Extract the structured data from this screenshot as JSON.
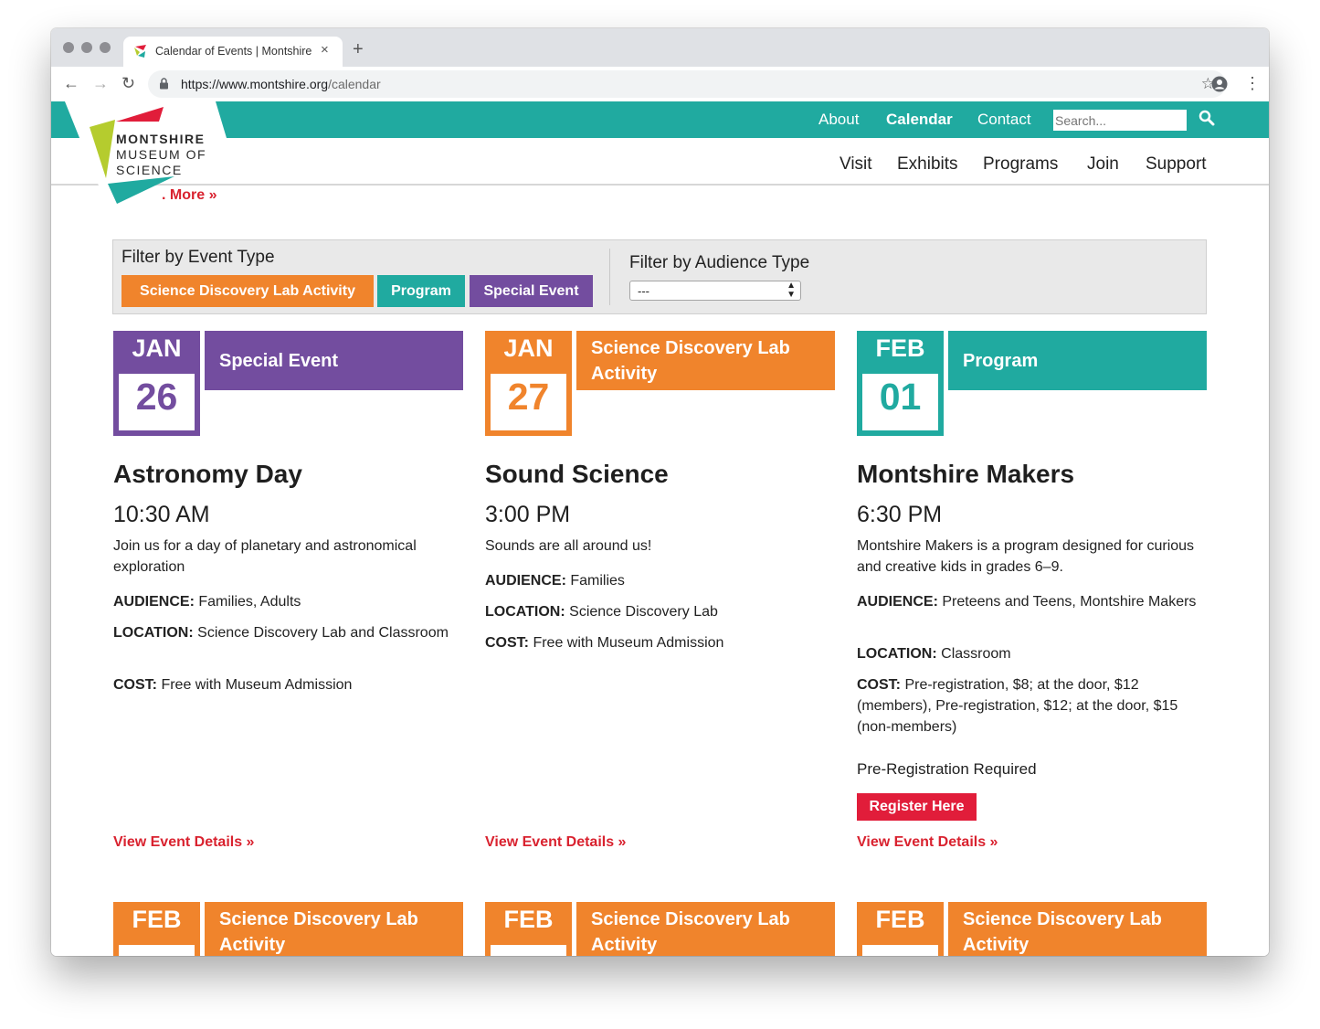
{
  "browser": {
    "tab_title": "Calendar of Events | Montshire",
    "tab_close": "×",
    "new_tab": "+",
    "url_host": "https://www.montshire.org",
    "url_path": "/calendar"
  },
  "site": {
    "top_nav": [
      "About",
      "Calendar",
      "Contact"
    ],
    "search_placeholder": "Search...",
    "main_nav": [
      "Visit",
      "Exhibits",
      "Programs",
      "Join",
      "Support"
    ],
    "logo_lines": [
      "MONTSHIRE",
      "MUSEUM OF",
      "SCIENCE"
    ],
    "read_more": ". More »"
  },
  "filter": {
    "event_heading": "Filter by Event Type",
    "buttons": [
      "Science Discovery Lab Activity",
      "Program",
      "Special Event"
    ],
    "audience_heading": "Filter by Audience Type",
    "audience_selected": "---"
  },
  "colors": {
    "teal": "#20aaa0",
    "orange": "#f0842c",
    "purple": "#734d9f",
    "red": "#d9222f"
  },
  "events": [
    {
      "month": "JAN",
      "day": "26",
      "type": "Special Event",
      "title": "Astronomy Day",
      "time": "10:30 AM",
      "description": "Join us for a day of planetary and astronomical exploration",
      "audience_label": "AUDIENCE:",
      "audience": "Families, Adults",
      "location_label": "LOCATION:",
      "location": "Science Discovery Lab and Classroom",
      "cost_label": "COST:",
      "cost": "Free with Museum Admission",
      "details": "View Event Details »"
    },
    {
      "month": "JAN",
      "day": "27",
      "type": "Science Discovery Lab Activity",
      "title": "Sound Science",
      "time": "3:00 PM",
      "description": "Sounds are all around us!",
      "audience_label": "AUDIENCE:",
      "audience": "Families",
      "location_label": "LOCATION:",
      "location": "Science Discovery Lab",
      "cost_label": "COST:",
      "cost": "Free with Museum Admission",
      "details": "View Event Details »"
    },
    {
      "month": "FEB",
      "day": "01",
      "type": "Program",
      "title": "Montshire Makers",
      "time": "6:30 PM",
      "description": "Montshire Makers is a program designed for curious and creative kids in grades 6–9.",
      "audience_label": "AUDIENCE:",
      "audience": "Preteens and Teens, Montshire Makers",
      "location_label": "LOCATION:",
      "location": "Classroom",
      "cost_label": "COST:",
      "cost": "Pre-registration, $8; at the door, $12 (members), Pre-registration, $12; at the door, $15 (non-members)",
      "prereg": "Pre-Registration Required",
      "register": "Register Here",
      "details": "View Event Details »"
    }
  ],
  "next_row": [
    {
      "month": "FEB",
      "type": "Science Discovery Lab Activity"
    },
    {
      "month": "FEB",
      "type": "Science Discovery Lab Activity"
    },
    {
      "month": "FEB",
      "type": "Science Discovery Lab Activity"
    }
  ]
}
